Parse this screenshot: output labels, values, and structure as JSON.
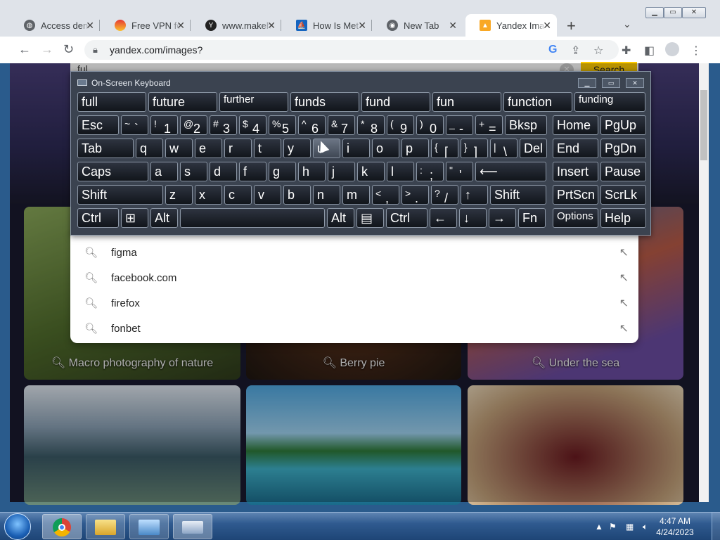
{
  "browser": {
    "tabs": [
      {
        "title": "Access deni",
        "icon": "globe-icon",
        "active": false
      },
      {
        "title": "Free VPN fo",
        "icon": "vpn-icon",
        "active": false
      },
      {
        "title": "www.makeh",
        "icon": "yandex-icon",
        "active": false
      },
      {
        "title": "How Is Met",
        "icon": "sail-icon",
        "active": false
      },
      {
        "title": "New Tab",
        "icon": "chrome-icon",
        "active": false
      },
      {
        "title": "Yandex Ima",
        "icon": "image-icon",
        "active": true
      }
    ],
    "new_tab": "+",
    "tab_search": "⌄",
    "url": "yandex.com/images?"
  },
  "page": {
    "search_value": "ful",
    "search_button": "Search",
    "cards": [
      {
        "label": "Macro photography of nature"
      },
      {
        "label": "Berry pie"
      },
      {
        "label": "Under the sea"
      }
    ],
    "suggestions": [
      "figma",
      "facebook.com",
      "firefox",
      "fonbet"
    ]
  },
  "osk": {
    "title": "On-Screen Keyboard",
    "predictions": [
      "full",
      "future",
      "further",
      "funds",
      "fund",
      "fun",
      "function",
      "funding"
    ],
    "row1": [
      {
        "main": "Esc"
      },
      {
        "main": "`",
        "sup": "~"
      },
      {
        "main": "1",
        "sup": "!"
      },
      {
        "main": "2",
        "sup": "@"
      },
      {
        "main": "3",
        "sup": "#"
      },
      {
        "main": "4",
        "sup": "$"
      },
      {
        "main": "5",
        "sup": "%"
      },
      {
        "main": "6",
        "sup": "^"
      },
      {
        "main": "7",
        "sup": "&"
      },
      {
        "main": "8",
        "sup": "*"
      },
      {
        "main": "9",
        "sup": "("
      },
      {
        "main": "0",
        "sup": ")"
      },
      {
        "main": "-",
        "sup": "_"
      },
      {
        "main": "=",
        "sup": "+"
      },
      {
        "main": "Bksp"
      }
    ],
    "row2": [
      "Tab",
      "q",
      "w",
      "e",
      "r",
      "t",
      "y",
      "u",
      "i",
      "o",
      "p",
      "[",
      "]",
      "\\",
      "Del"
    ],
    "row3": [
      "Caps",
      "a",
      "s",
      "d",
      "f",
      "g",
      "h",
      "j",
      "k",
      "l",
      ";",
      "'",
      "⟵"
    ],
    "row4": [
      "Shift",
      "z",
      "x",
      "c",
      "v",
      "b",
      "n",
      "m",
      ",",
      ".",
      "/",
      "↑",
      "Shift"
    ],
    "row5": [
      "Ctrl",
      "⊞",
      "Alt",
      "",
      "Alt",
      "▤",
      "Ctrl",
      "←",
      "↓",
      "→",
      "Fn"
    ],
    "row2_sups": {
      "[": "{",
      "]": "}",
      "\\": "|"
    },
    "row3_sups": {
      ";": ":",
      "'": "\""
    },
    "row4_sups": {
      ",": "<",
      ".": ">",
      "/": "?"
    },
    "right_keys": [
      "Home",
      "PgUp",
      "End",
      "PgDn",
      "Insert",
      "Pause",
      "PrtScn",
      "ScrLk",
      "Options",
      "Help"
    ]
  },
  "taskbar": {
    "time": "4:47 AM",
    "date": "4/24/2023"
  }
}
